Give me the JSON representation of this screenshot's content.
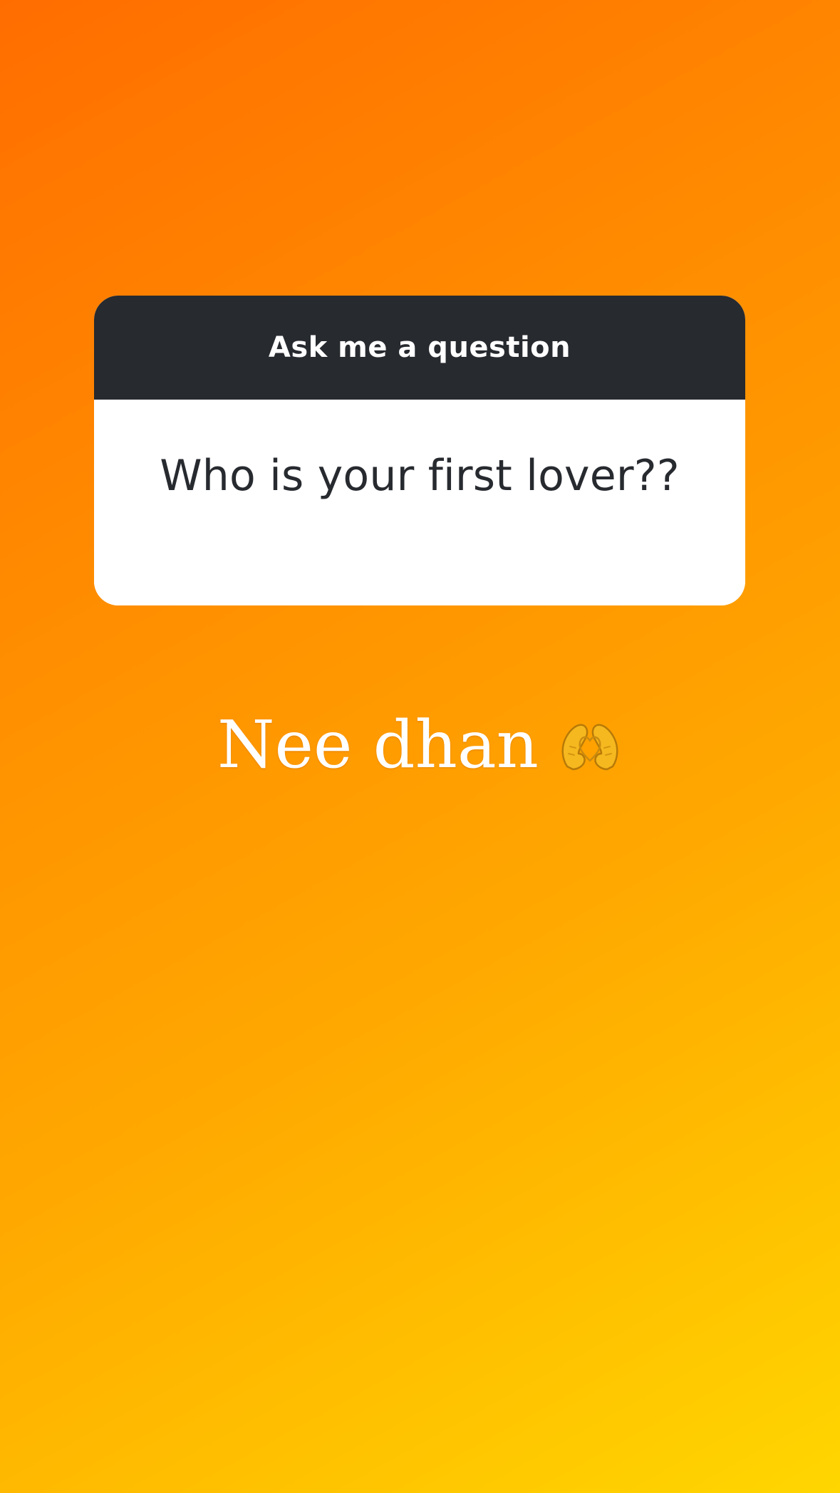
{
  "story": {
    "background_gradient": [
      "#ff6d00",
      "#ff8a00",
      "#ffa800",
      "#ffd600"
    ]
  },
  "question_sticker": {
    "header_title": "Ask me a question",
    "question_text": "Who is your first lover??",
    "header_color": "#272a2f",
    "body_color": "#ffffff"
  },
  "answer": {
    "text": "Nee dhan",
    "emoji_icon": "heart-hands-icon",
    "text_color": "#ffffff"
  }
}
